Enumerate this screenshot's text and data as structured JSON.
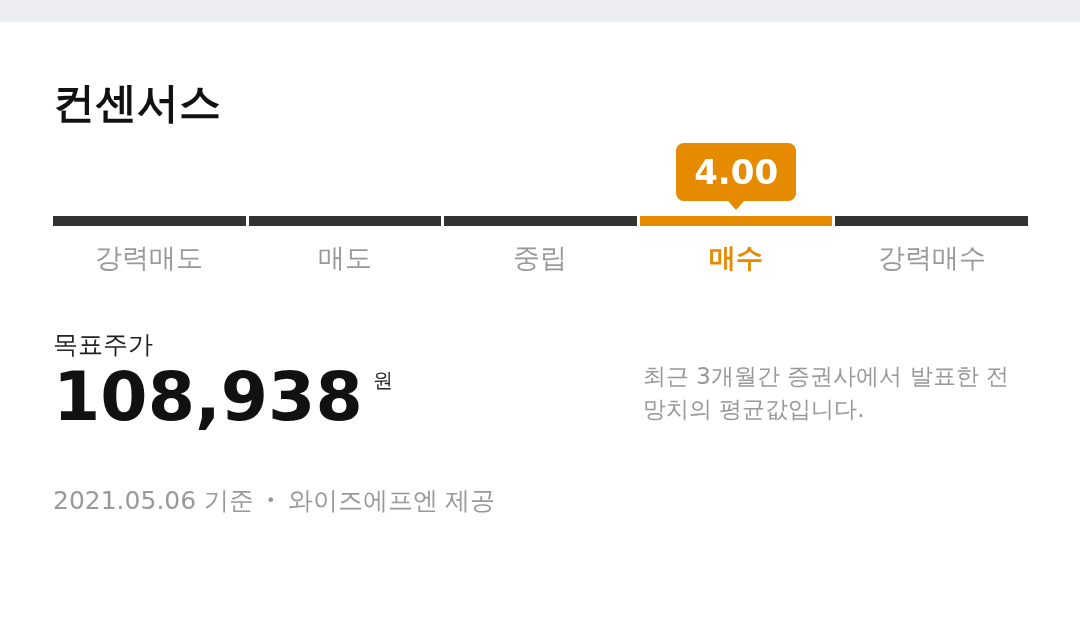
{
  "title": "컨센서스",
  "rating": {
    "score": "4.00",
    "segments": [
      {
        "label": "강력매도",
        "selected": false
      },
      {
        "label": "매도",
        "selected": false
      },
      {
        "label": "중립",
        "selected": false
      },
      {
        "label": "매수",
        "selected": true
      },
      {
        "label": "강력매수",
        "selected": false
      }
    ]
  },
  "target_price": {
    "label": "목표주가",
    "value": "108,938",
    "unit": "원",
    "note": "최근 3개월간 증권사에서 발표한 전망치의 평균값입니다."
  },
  "footer": {
    "date": "2021.05.06 기준",
    "separator": "•",
    "provider": "와이즈에프엔 제공"
  }
}
